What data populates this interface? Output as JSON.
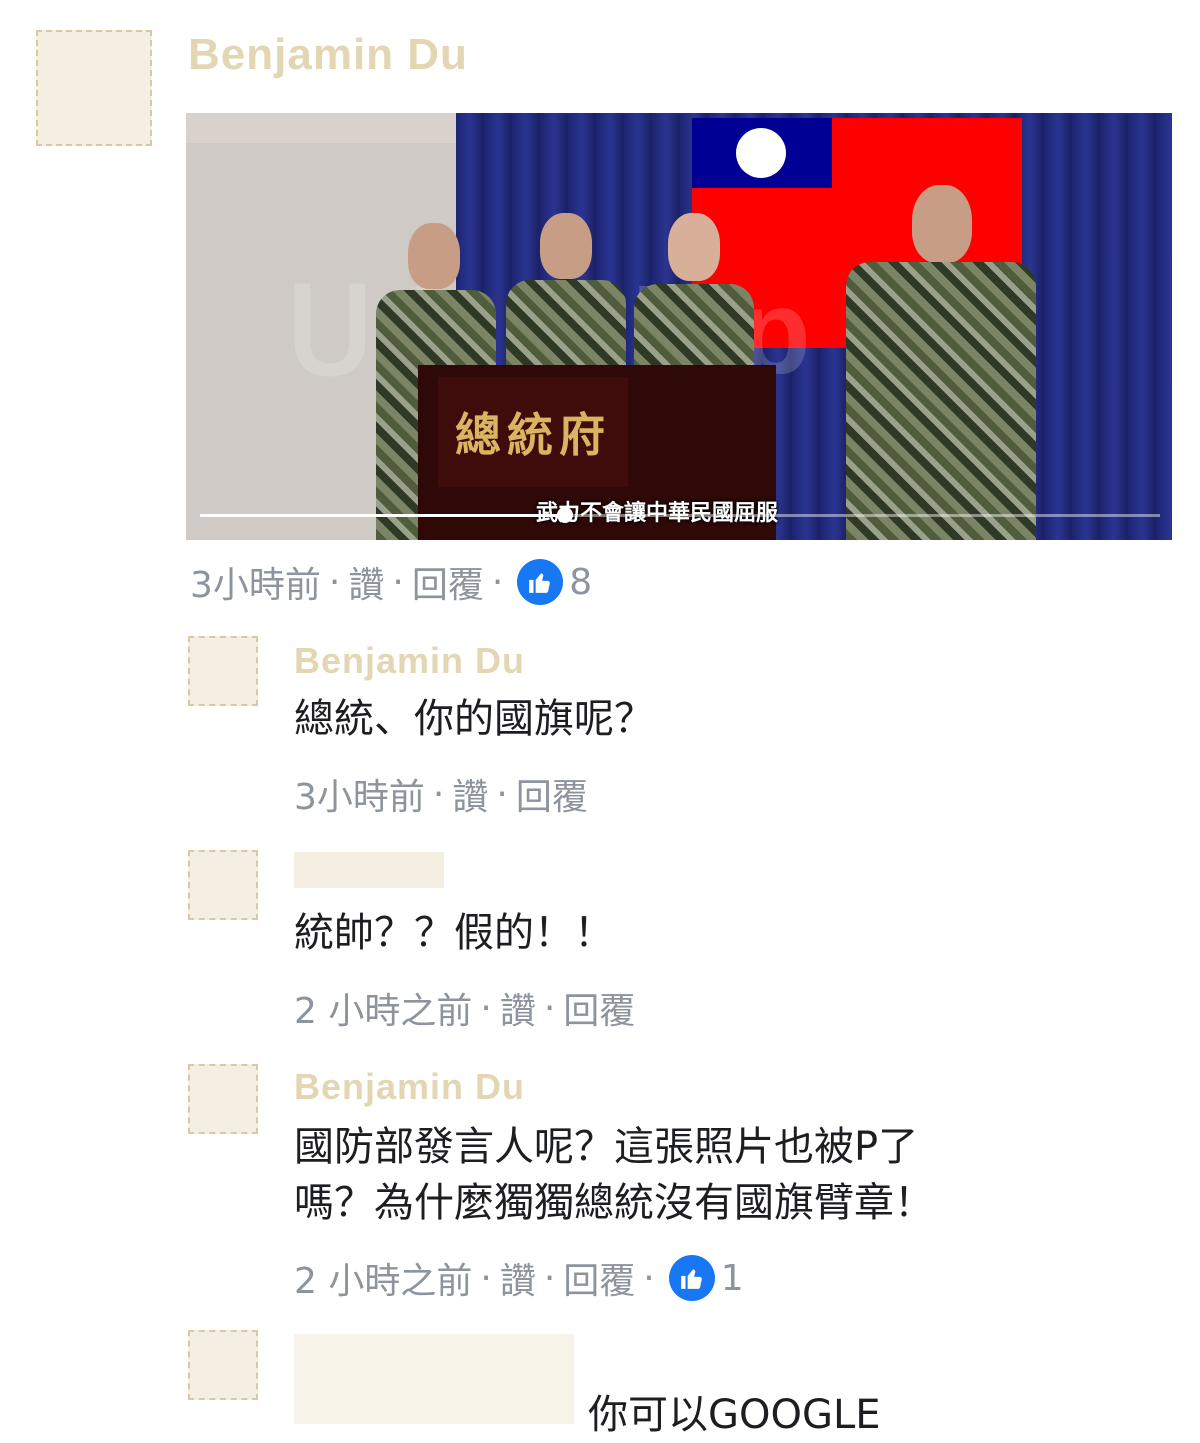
{
  "comments": [
    {
      "author": "Benjamin Du",
      "video": {
        "caption": "武力不會讓中華民國屈服",
        "podium_text": "總統府",
        "progress": 0.38
      },
      "meta": {
        "time": "3小時前",
        "like": "讚",
        "reply": "回覆",
        "reactions": "8"
      }
    },
    {
      "author": "Benjamin Du",
      "text": "總統、你的國旗呢？",
      "meta": {
        "time": "3小時前",
        "like": "讚",
        "reply": "回覆"
      }
    },
    {
      "text": "統帥？？假的！！",
      "meta": {
        "time": "2 小時之前",
        "like": "讚",
        "reply": "回覆"
      }
    },
    {
      "author": "Benjamin Du",
      "text_line1": "國防部發言人呢？這張照片也被P了",
      "text_line2": "嗎？為什麼獨獨總統沒有國旗臂章！",
      "meta": {
        "time": "2 小時之前",
        "like": "讚",
        "reply": "回覆",
        "reactions": "1"
      }
    },
    {
      "text": "你可以GOOGLE"
    }
  ],
  "separator": "·",
  "colors": {
    "like_blue": "#1877f2",
    "meta_gray": "#8d949e"
  }
}
